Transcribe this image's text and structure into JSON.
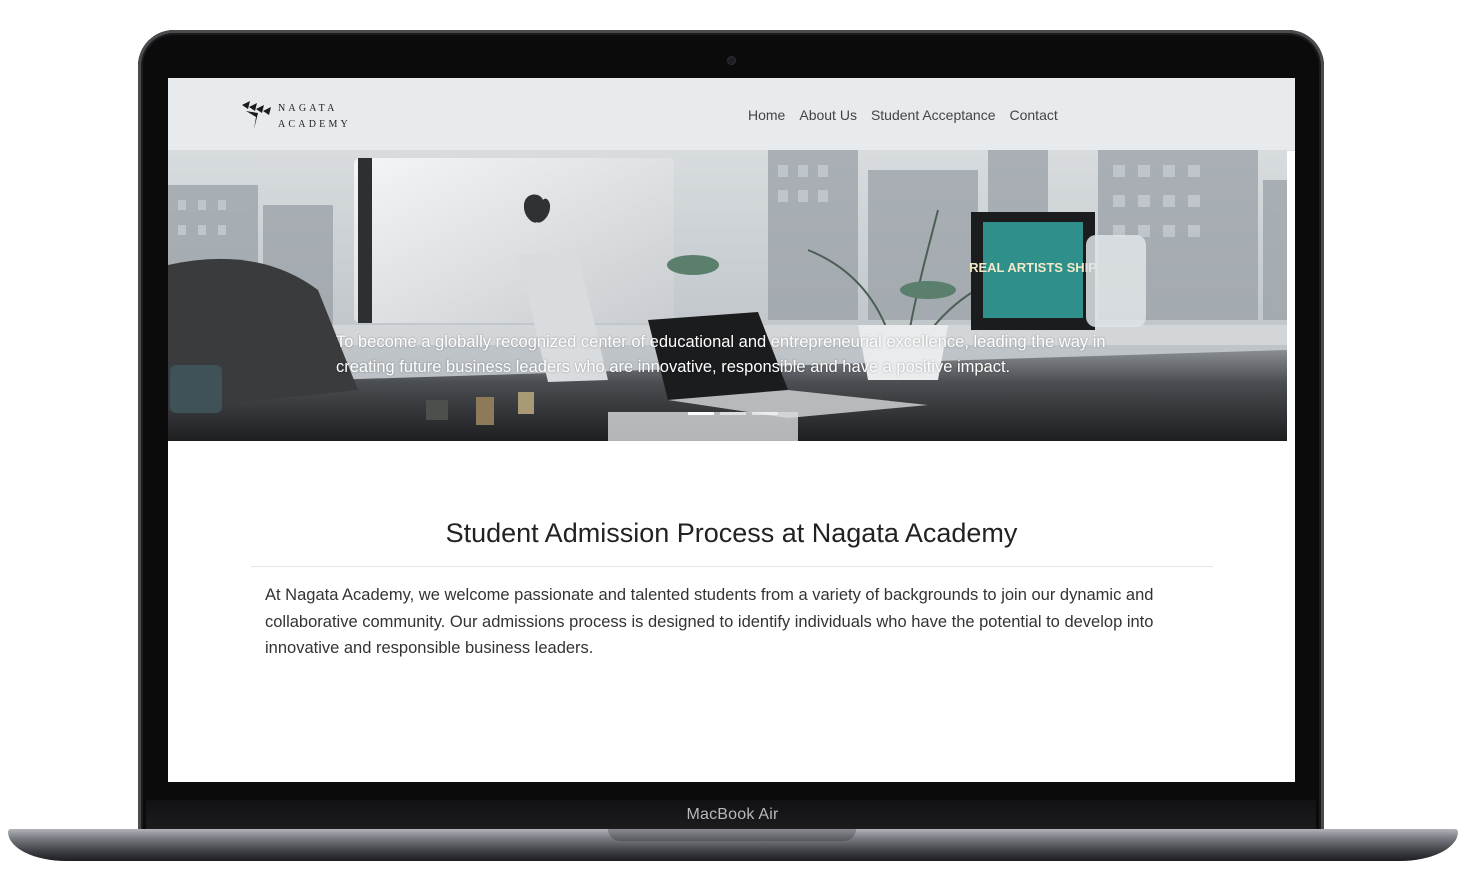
{
  "device": {
    "model_label": "MacBook Air"
  },
  "brand": {
    "line1": "NAGATA",
    "line2": "ACADEMY"
  },
  "nav": {
    "items": [
      {
        "label": "Home"
      },
      {
        "label": "About Us"
      },
      {
        "label": "Student Acceptance"
      },
      {
        "label": "Contact"
      }
    ]
  },
  "hero": {
    "caption": "To become a globally recognized center of educational and entrepreneurial excellence, leading the way in creating future business leaders who are innovative, responsible and have a positive impact.",
    "poster_text": "REAL ARTISTS SHIP",
    "active_slide": 1,
    "slide_count": 3
  },
  "main": {
    "title": "Student Admission Process at Nagata Academy",
    "body": "At Nagata Academy, we welcome passionate and talented students from a variety of backgrounds to join our dynamic and collaborative community. Our admissions process is designed to identify individuals who have the potential to develop into innovative and responsible business leaders."
  },
  "colors": {
    "navbar_bg": "#e8ebed",
    "nav_text": "#444444",
    "heading_text": "#222222",
    "body_text": "#333333",
    "poster_teal": "#2f8f8a"
  }
}
